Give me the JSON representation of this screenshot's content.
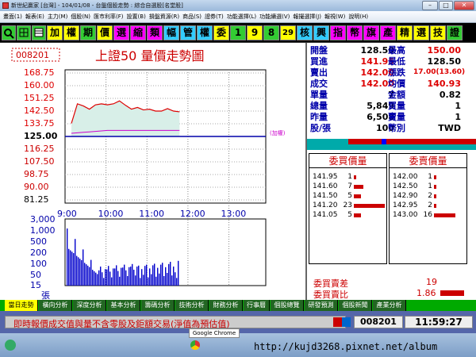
{
  "titlebar": {
    "title": "新世紀贏家 [台灣] - 104/01/08 - 台盤個股走勢 : 綜合自選股[名堂股]"
  },
  "menu": [
    "畫面(1)",
    "報表(E)",
    "主力(M)",
    "個股(N)",
    "匯市利率(F)",
    "設置(B)",
    "損盤資源(R)",
    "商品(S)",
    "證券(T)",
    "功能選擇(L)",
    "功能續選(V)",
    "報撮選擇(J)",
    "報視(W)",
    "說明(H)"
  ],
  "toolbar": {
    "buttons": [
      "加",
      "權",
      "期",
      "價",
      "選",
      "縮",
      "類",
      "幅",
      "管",
      "權",
      "委",
      "1",
      "9",
      "8",
      "29",
      "核",
      "興",
      "指",
      "幣",
      "旗",
      "產",
      "精",
      "選",
      "技",
      "證"
    ]
  },
  "chart": {
    "code": "008201",
    "title": "上證50  量價走勢圖",
    "tag": "(加權)",
    "price_ticks": [
      "168.75",
      "160.00",
      "151.25",
      "142.50",
      "133.75",
      "125.00",
      "116.25",
      "107.50",
      "98.75",
      "90.00",
      "81.25"
    ],
    "vol_ticks": [
      "3,000",
      "1,000",
      "500",
      "200",
      "100",
      "50",
      "15",
      "張"
    ],
    "time_ticks": [
      "9:00",
      "10:00",
      "11:00",
      "12:00",
      "13:00"
    ]
  },
  "chart_data": {
    "type": "line",
    "title": "上證50  量價走勢圖",
    "x": [
      "9:00",
      "9:10",
      "9:20",
      "9:30",
      "9:40",
      "9:50",
      "10:00",
      "10:10",
      "10:20",
      "10:30",
      "10:40",
      "10:50",
      "11:00",
      "11:10",
      "11:20",
      "11:30",
      "11:40",
      "11:50",
      "12:00"
    ],
    "series": [
      {
        "values": [
          134.0,
          147.5,
          146.0,
          143.8,
          146.8,
          147.5,
          146.8,
          147.5,
          149.5,
          146.5,
          143.8,
          145.0,
          143.3,
          143.8,
          142.5,
          142.5,
          144.2,
          142.5,
          142.0
        ]
      }
    ],
    "ylim": [
      81.25,
      168.75
    ]
  },
  "quote": [
    {
      "k": "開盤",
      "v": "128.50",
      "k2": "最高",
      "v2": "150.00"
    },
    {
      "k": "買進",
      "v": "141.95",
      "k2": "最低",
      "v2": "128.50"
    },
    {
      "k": "賣出",
      "v": "142.00",
      "k2": "漲跌",
      "v2": "17.00(13.60)"
    },
    {
      "k": "成交",
      "v": "142.00",
      "k2": "均價",
      "v2": "140.93"
    },
    {
      "k": "單量",
      "v": "7",
      "k2": "金額",
      "v2": "0.82"
    },
    {
      "k": "總量",
      "v": "5,849",
      "k2": "買量",
      "v2": "1"
    },
    {
      "k": "昨量",
      "v": "6,508",
      "k2": "賣量",
      "v2": "1"
    },
    {
      "k": "股/張",
      "v": "100",
      "k2": "幣別",
      "v2": "TWD"
    }
  ],
  "orders": {
    "buy_header": "委買價量",
    "sell_header": "委賣價量",
    "buy": [
      {
        "p": "141.95",
        "q": "1"
      },
      {
        "p": "141.60",
        "q": "7"
      },
      {
        "p": "141.50",
        "q": "5"
      },
      {
        "p": "141.20",
        "q": "23"
      },
      {
        "p": "141.05",
        "q": "5"
      }
    ],
    "sell": [
      {
        "p": "142.00",
        "q": "1"
      },
      {
        "p": "142.50",
        "q": "1"
      },
      {
        "p": "142.90",
        "q": "2"
      },
      {
        "p": "142.95",
        "q": "2"
      },
      {
        "p": "143.00",
        "q": "16"
      }
    ],
    "diff_label": "委買賣差",
    "diff_value": "19",
    "ratio_label": "委買賣比",
    "ratio_value": "1.86"
  },
  "tabs": [
    "當日走勢",
    "橫向分析",
    "深度分析",
    "基本分析",
    "籌碼分析",
    "技術分析",
    "財務分析",
    "行事曆",
    "個股總覽",
    "研發預測",
    "個股新聞",
    "產業分析"
  ],
  "status": {
    "note": "即時報價成交值與量不含零股及鉅額交易(淨值為預估值)",
    "code": "008201",
    "time": "11:59:27"
  },
  "taskbar": {
    "tooltip": "Google Chrome",
    "url": "http://kujd3268.pixnet.net/album"
  },
  "colors": {
    "up": "#d00000",
    "down": "#007a00",
    "label": "#0000a0",
    "toolbar_bg": "#000000",
    "volume": "#0000cc"
  }
}
